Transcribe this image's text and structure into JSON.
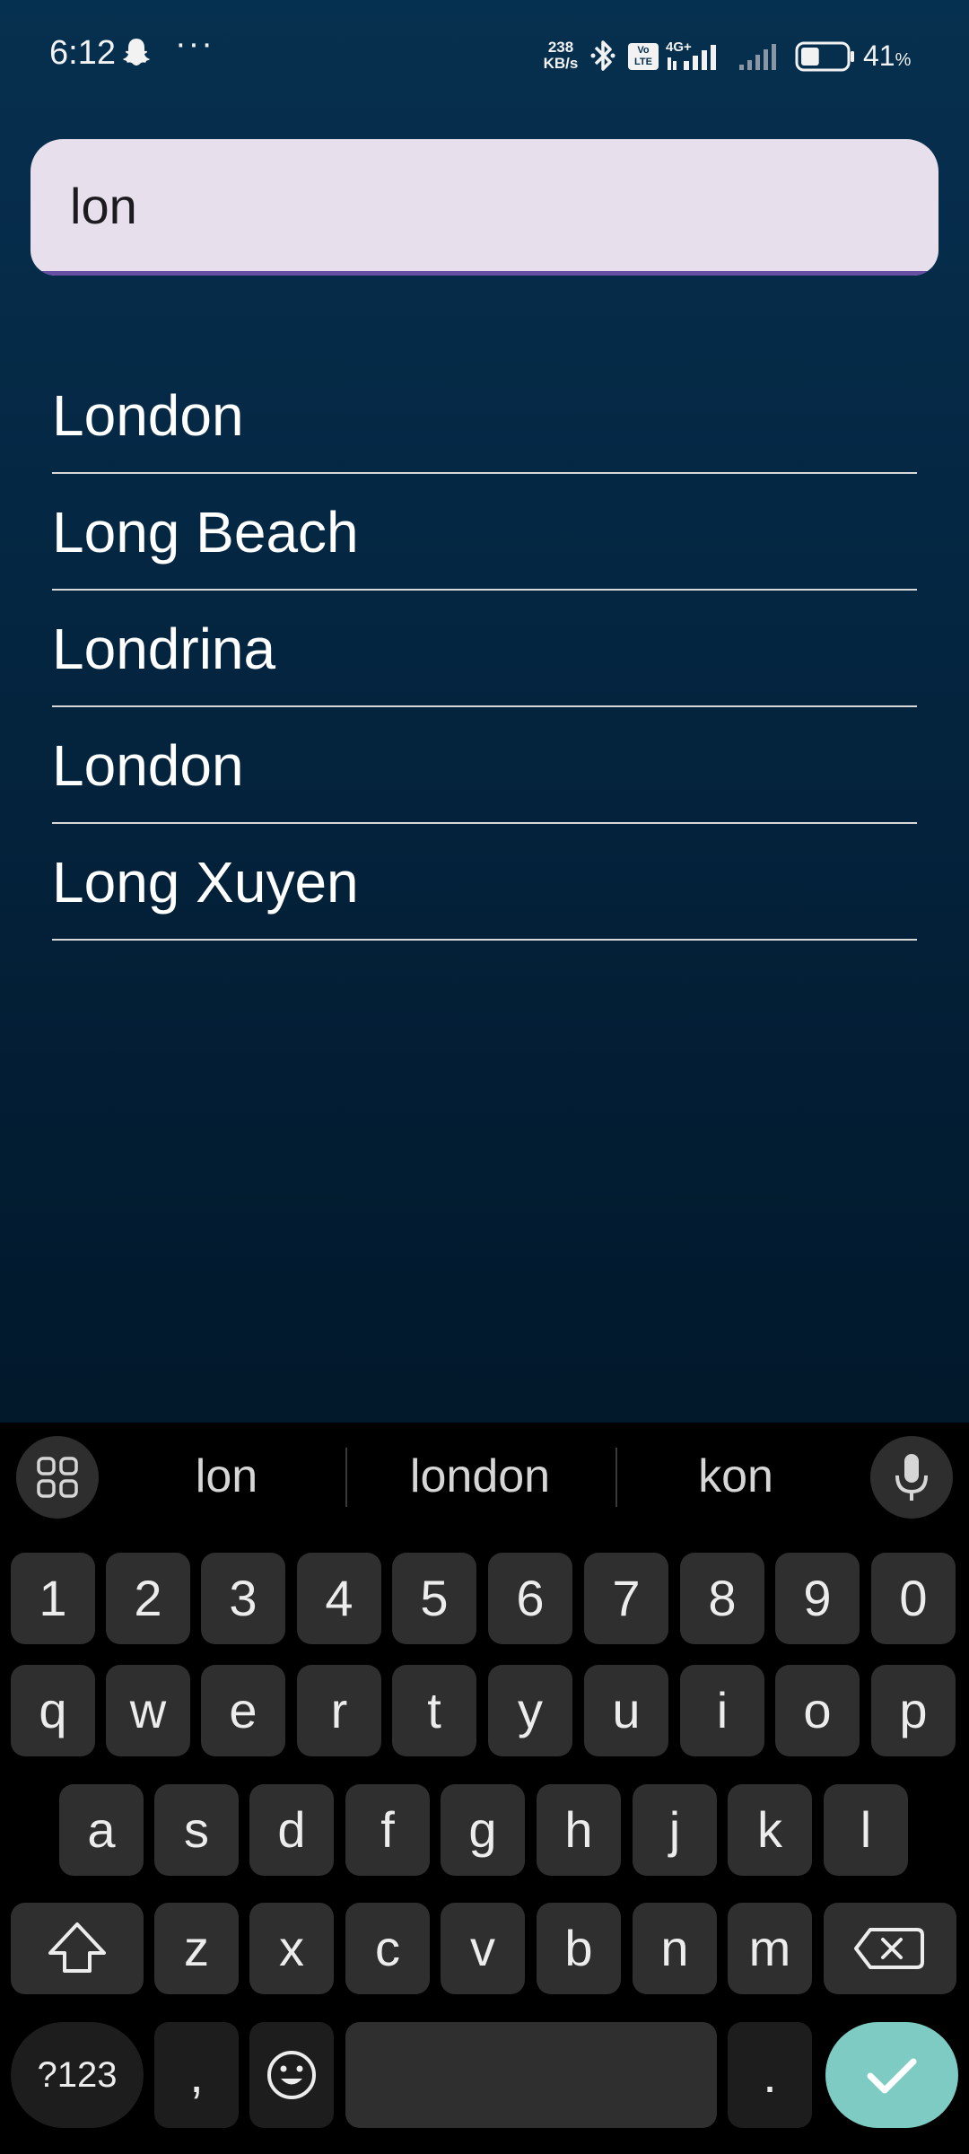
{
  "status_bar": {
    "time": "6:12",
    "more": "···",
    "net_speed_value": "238",
    "net_speed_unit": "KB/s",
    "volte_top": "Vo",
    "volte_bottom": "LTE",
    "network_type": "4G+",
    "battery_percent": "41",
    "battery_percent_sign": "%",
    "battery_level": 0.41
  },
  "search": {
    "value": "lon",
    "accent_color": "#6750a4"
  },
  "results": [
    {
      "label": "London"
    },
    {
      "label": "Long Beach"
    },
    {
      "label": "Londrina"
    },
    {
      "label": "London"
    },
    {
      "label": "Long Xuyen"
    }
  ],
  "keyboard": {
    "suggestions": [
      "lon",
      "london",
      "kon"
    ],
    "row_numbers": [
      "1",
      "2",
      "3",
      "4",
      "5",
      "6",
      "7",
      "8",
      "9",
      "0"
    ],
    "row_top": [
      "q",
      "w",
      "e",
      "r",
      "t",
      "y",
      "u",
      "i",
      "o",
      "p"
    ],
    "row_home": [
      "a",
      "s",
      "d",
      "f",
      "g",
      "h",
      "j",
      "k",
      "l"
    ],
    "row_bottom": [
      "z",
      "x",
      "c",
      "v",
      "b",
      "n",
      "m"
    ],
    "symbols_label": "?123",
    "comma_label": ",",
    "period_label": ".",
    "enter_color": "#7ecbc4"
  }
}
